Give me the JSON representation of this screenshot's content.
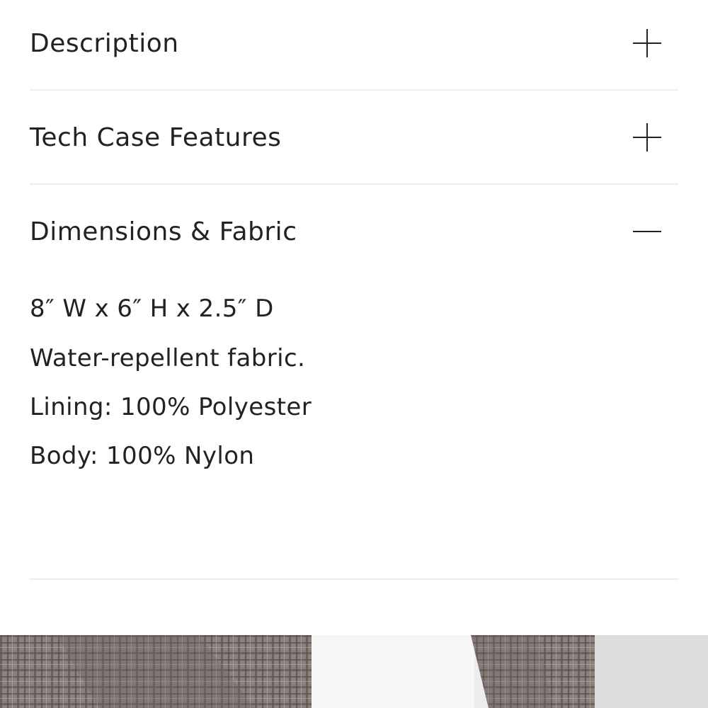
{
  "accordion": {
    "sections": [
      {
        "title": "Description",
        "state": "collapsed",
        "icon": "plus-icon"
      },
      {
        "title": "Tech Case Features",
        "state": "collapsed",
        "icon": "plus-icon"
      },
      {
        "title": "Dimensions & Fabric",
        "state": "expanded",
        "icon": "minus-icon"
      }
    ],
    "dimensions_fabric_details": [
      "8″ W x 6″ H x 2.5″ D",
      "Water-repellent fabric.",
      "Lining: 100% Polyester",
      "Body: 100% Nylon"
    ]
  },
  "colors": {
    "text": "#222222",
    "divider": "#ededed",
    "background": "#ffffff",
    "plaid": "#7d7370"
  }
}
